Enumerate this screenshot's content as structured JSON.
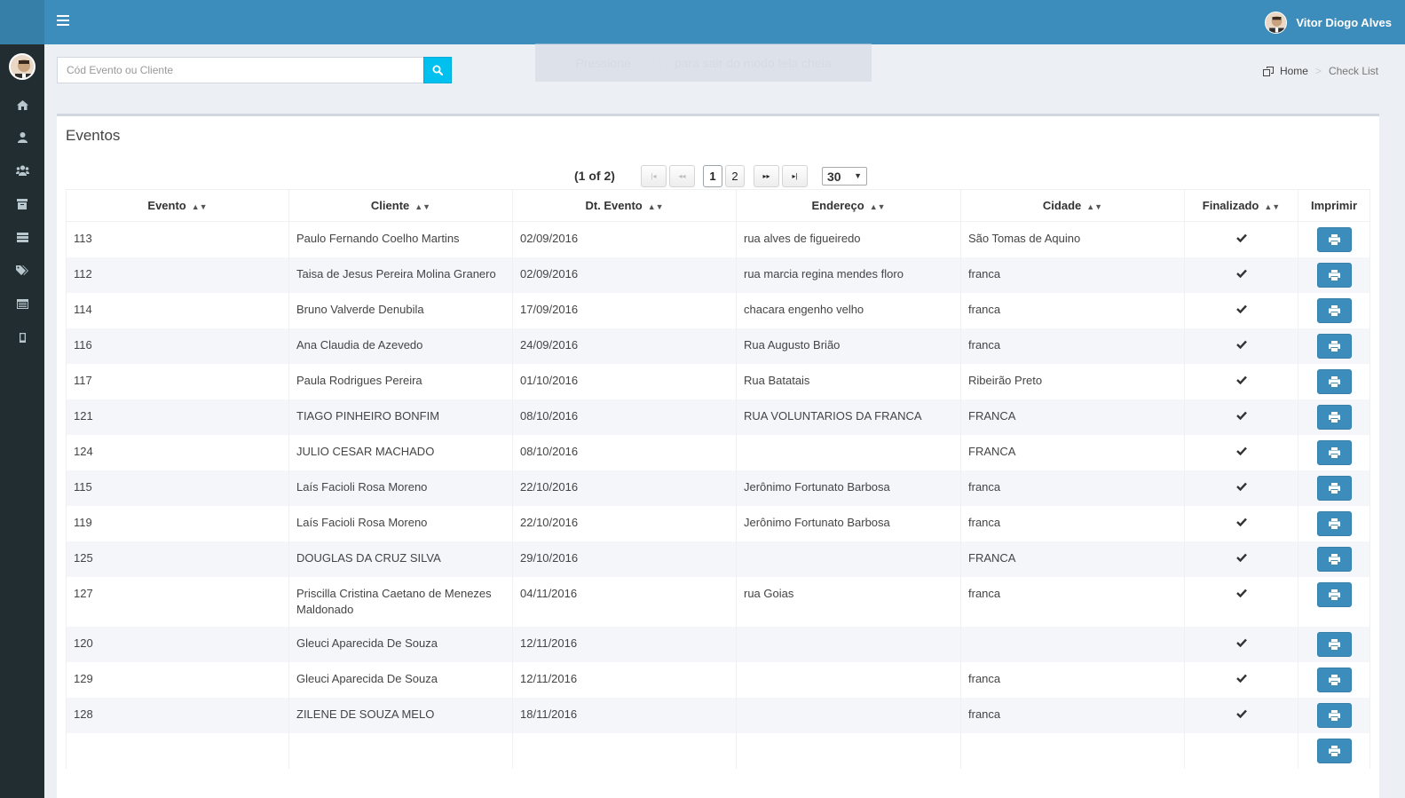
{
  "header": {
    "user_name": "Vitor Diogo Alves"
  },
  "search": {
    "placeholder": "Cód Evento ou Cliente"
  },
  "fullscreen_notice": {
    "before": "Pressione",
    "key": "F11",
    "after": "para sair do modo tela cheia"
  },
  "breadcrumb": {
    "home": "Home",
    "current": "Check List"
  },
  "sidebar": {
    "items": [
      "home-icon",
      "user-icon",
      "users-icon",
      "archive-icon",
      "list-icon",
      "tags-icon",
      "calendar-icon",
      "mobile-icon"
    ]
  },
  "box": {
    "title": "Eventos"
  },
  "paginator": {
    "info": "(1 of 2)",
    "first": "⏮",
    "prev": "⏪",
    "pages": [
      "1",
      "2"
    ],
    "next": "⏩",
    "last": "⏭",
    "rows_per_page": "30"
  },
  "table": {
    "columns": [
      "Evento",
      "Cliente",
      "Dt. Evento",
      "Endereço",
      "Cidade",
      "Finalizado",
      "Imprimir"
    ],
    "rows": [
      {
        "evento": "113",
        "cliente": "Paulo Fernando Coelho Martins",
        "data": "02/09/2016",
        "endereco": "rua alves de figueiredo",
        "cidade": "São Tomas de Aquino"
      },
      {
        "evento": "112",
        "cliente": "Taisa de Jesus Pereira Molina Granero",
        "data": "02/09/2016",
        "endereco": "rua marcia regina mendes floro",
        "cidade": "franca"
      },
      {
        "evento": "114",
        "cliente": "Bruno Valverde Denubila",
        "data": "17/09/2016",
        "endereco": "chacara engenho velho",
        "cidade": "franca"
      },
      {
        "evento": "116",
        "cliente": "Ana Claudia de Azevedo",
        "data": "24/09/2016",
        "endereco": "Rua Augusto Brião",
        "cidade": "franca"
      },
      {
        "evento": "117",
        "cliente": "Paula Rodrigues Pereira",
        "data": "01/10/2016",
        "endereco": "Rua Batatais",
        "cidade": "Ribeirão Preto"
      },
      {
        "evento": "121",
        "cliente": "TIAGO PINHEIRO BONFIM",
        "data": "08/10/2016",
        "endereco": "RUA VOLUNTARIOS DA FRANCA",
        "cidade": "FRANCA"
      },
      {
        "evento": "124",
        "cliente": "JULIO CESAR MACHADO",
        "data": "08/10/2016",
        "endereco": "",
        "cidade": "FRANCA"
      },
      {
        "evento": "115",
        "cliente": "Laís Facioli Rosa Moreno",
        "data": "22/10/2016",
        "endereco": "Jerônimo Fortunato Barbosa",
        "cidade": "franca"
      },
      {
        "evento": "119",
        "cliente": "Laís Facioli Rosa Moreno",
        "data": "22/10/2016",
        "endereco": "Jerônimo Fortunato Barbosa",
        "cidade": "franca"
      },
      {
        "evento": "125",
        "cliente": "DOUGLAS DA CRUZ SILVA",
        "data": "29/10/2016",
        "endereco": "",
        "cidade": "FRANCA"
      },
      {
        "evento": "127",
        "cliente": "Priscilla Cristina Caetano de Menezes Maldonado",
        "data": "04/11/2016",
        "endereco": "rua Goias",
        "cidade": "franca"
      },
      {
        "evento": "120",
        "cliente": "Gleuci Aparecida De Souza",
        "data": "12/11/2016",
        "endereco": "",
        "cidade": ""
      },
      {
        "evento": "129",
        "cliente": "Gleuci Aparecida De Souza",
        "data": "12/11/2016",
        "endereco": "",
        "cidade": "franca"
      },
      {
        "evento": "128",
        "cliente": "ZILENE DE SOUZA MELO",
        "data": "18/11/2016",
        "endereco": "",
        "cidade": "franca"
      },
      {
        "evento": "",
        "cliente": "",
        "data": "",
        "endereco": "",
        "cidade": ""
      }
    ]
  },
  "colors": {
    "topbar": "#3c8dbc",
    "sidebar": "#222d32",
    "search_button": "#00c0ef",
    "print_button": "#3c8dbc"
  }
}
